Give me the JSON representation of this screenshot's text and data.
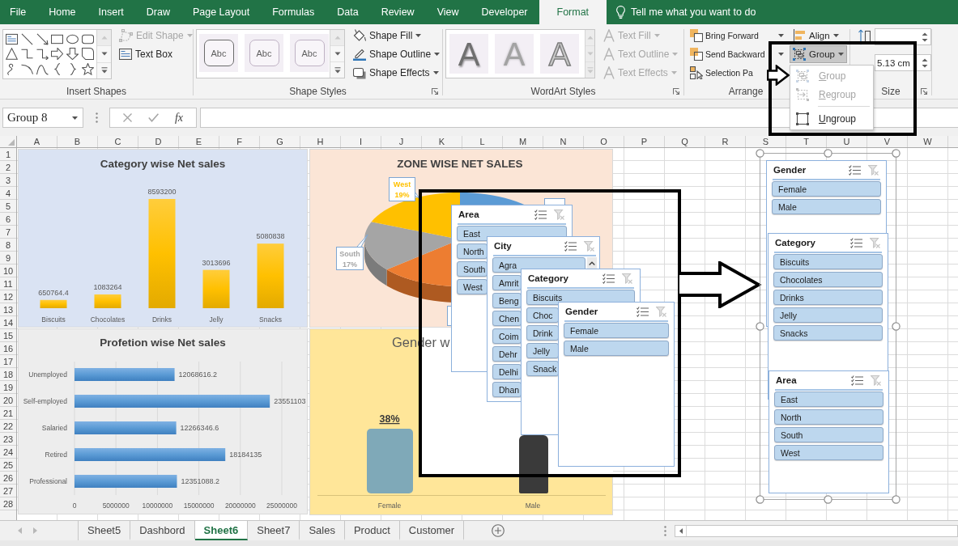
{
  "ribbon": {
    "tabs": [
      {
        "label": "File",
        "selected": false
      },
      {
        "label": "Home",
        "selected": false
      },
      {
        "label": "Insert",
        "selected": false
      },
      {
        "label": "Draw",
        "selected": false
      },
      {
        "label": "Page Layout",
        "selected": false
      },
      {
        "label": "Formulas",
        "selected": false
      },
      {
        "label": "Data",
        "selected": false
      },
      {
        "label": "Review",
        "selected": false
      },
      {
        "label": "View",
        "selected": false
      },
      {
        "label": "Developer",
        "selected": false
      },
      {
        "label": "Format",
        "selected": true
      }
    ],
    "tell_me": "Tell me what you want to do",
    "insert_shapes": {
      "label": "Insert Shapes",
      "commands": [
        {
          "label": "Edit Shape",
          "menu": true,
          "disabled": true
        },
        {
          "label": "Text Box",
          "menu": false,
          "disabled": false
        }
      ]
    },
    "shape_styles": {
      "label": "Shape Styles",
      "presets": [
        {
          "label": "Abc",
          "kind": "outlined"
        },
        {
          "label": "Abc",
          "kind": "light"
        },
        {
          "label": "Abc",
          "kind": "light"
        }
      ],
      "commands": [
        {
          "label": "Shape Fill",
          "menu": true,
          "disabled": false
        },
        {
          "label": "Shape Outline",
          "menu": true,
          "disabled": false
        },
        {
          "label": "Shape Effects",
          "menu": true,
          "disabled": false
        }
      ]
    },
    "wordart_styles": {
      "label": "WordArt Styles",
      "presets": [
        {
          "label": "A",
          "kind": "solid"
        },
        {
          "label": "A",
          "kind": "faded"
        },
        {
          "label": "A",
          "kind": "outline"
        }
      ],
      "commands": [
        {
          "label": "Text Fill",
          "menu": true,
          "disabled": true
        },
        {
          "label": "Text Outline",
          "menu": true,
          "disabled": true
        },
        {
          "label": "Text Effects",
          "menu": true,
          "disabled": true
        }
      ]
    },
    "arrange": {
      "label": "Arrange",
      "commands": [
        {
          "label": "Bring Forward",
          "menu": true
        },
        {
          "label": "Send Backward",
          "menu": true
        },
        {
          "label": "Selection Pa"
        }
      ],
      "align": {
        "label": "Align",
        "menu": true
      },
      "group": {
        "label": "Group",
        "menu": true,
        "pressed": true
      }
    },
    "size": {
      "label": "Size",
      "width": "5.13 cm"
    },
    "group_menu": [
      {
        "label": "Group",
        "disabled": true
      },
      {
        "label": "Regroup",
        "disabled": true
      },
      {
        "label": "Ungroup",
        "disabled": false
      }
    ]
  },
  "formula_bar": {
    "name_box": "Group 8",
    "function_label": "fx"
  },
  "sheet": {
    "columns": [
      "A",
      "B",
      "C",
      "D",
      "E",
      "F",
      "G",
      "H",
      "I",
      "J",
      "K",
      "L",
      "M",
      "N",
      "O",
      "P",
      "Q",
      "R",
      "S",
      "T",
      "U",
      "V",
      "W"
    ],
    "rows": [
      "1",
      "2",
      "3",
      "4",
      "5",
      "6",
      "7",
      "8",
      "9",
      "10",
      "11",
      "12",
      "13",
      "14",
      "15",
      "16",
      "17",
      "18",
      "19",
      "20",
      "21",
      "22",
      "23",
      "24",
      "25",
      "26",
      "27",
      "28"
    ]
  },
  "category_chart": {
    "chart_data": {
      "type": "bar",
      "title": "Category wise Net sales",
      "categories": [
        "Biscuits",
        "Chocolates",
        "Drinks",
        "Jelly",
        "Snacks"
      ],
      "values": [
        650764.4,
        1083264,
        8593200,
        3013696,
        5080838
      ],
      "data_labels": true
    }
  },
  "profession_chart": {
    "chart_data": {
      "type": "bar",
      "orientation": "horizontal",
      "title": "Profetion wise Net sales",
      "categories": [
        "Unemployed",
        "Self-employed",
        "Salaried",
        "Retired",
        "Professional"
      ],
      "values": [
        12068616.2,
        23551103,
        12266346.6,
        18184135,
        12351088.2
      ],
      "xlim": [
        0,
        25000000
      ],
      "xticks": [
        0,
        5000000,
        10000000,
        15000000,
        20000000,
        25000000
      ],
      "grid": true,
      "data_labels": true
    }
  },
  "zone_chart": {
    "title": "ZONE WISE NET SALES",
    "labels": [
      {
        "zone": "West",
        "percent": "19%",
        "color": "#ffc000"
      },
      {
        "zone": "South",
        "percent": "17%",
        "color": "#a5a5a5"
      }
    ]
  },
  "gender_chart": {
    "title": "Gender w",
    "percent": "38%",
    "categories": [
      "Female",
      "Male"
    ]
  },
  "slicers_before": [
    {
      "title": "Area",
      "kind": "plain",
      "items": [
        {
          "label": "East",
          "selected": true
        },
        {
          "label": "North",
          "selected": true
        },
        {
          "label": "South",
          "selected": true
        },
        {
          "label": "West",
          "selected": true
        }
      ]
    },
    {
      "title": "City",
      "kind": "scrolling",
      "items": [
        {
          "label": "Agra",
          "selected": true
        },
        {
          "label": "Amrit",
          "selected": true
        },
        {
          "label": "Beng",
          "selected": true
        },
        {
          "label": "Chen",
          "selected": true
        },
        {
          "label": "Coim",
          "selected": true
        },
        {
          "label": "Dehr",
          "selected": true
        },
        {
          "label": "Delhi",
          "selected": true
        },
        {
          "label": "Dhan",
          "selected": true
        }
      ]
    },
    {
      "title": "Category",
      "kind": "plain",
      "items": [
        {
          "label": "Biscuits",
          "selected": true
        },
        {
          "label": "Choc",
          "selected": true
        },
        {
          "label": "Drink",
          "selected": true
        },
        {
          "label": "Jelly",
          "selected": true
        },
        {
          "label": "Snack",
          "selected": true
        }
      ]
    },
    {
      "title": "Gender",
      "kind": "plain",
      "items": [
        {
          "label": "Female",
          "selected": true
        },
        {
          "label": "Male",
          "selected": true
        }
      ]
    }
  ],
  "slicers_after": [
    {
      "title": "Gender",
      "kind": "plain",
      "items": [
        {
          "label": "Female",
          "selected": true
        },
        {
          "label": "Male",
          "selected": true
        }
      ]
    },
    {
      "title": "Category",
      "kind": "plain",
      "items": [
        {
          "label": "Biscuits",
          "selected": true
        },
        {
          "label": "Chocolates",
          "selected": true
        },
        {
          "label": "Drinks",
          "selected": true
        },
        {
          "label": "Jelly",
          "selected": true
        },
        {
          "label": "Snacks",
          "selected": true
        }
      ]
    },
    {
      "title": "Area",
      "kind": "plain",
      "items": [
        {
          "label": "East",
          "selected": true
        },
        {
          "label": "North",
          "selected": true
        },
        {
          "label": "South",
          "selected": true
        },
        {
          "label": "West",
          "selected": true
        }
      ]
    }
  ],
  "sheet_tabs": [
    {
      "label": "Sheet5",
      "selected": false
    },
    {
      "label": "Dashbord",
      "selected": false
    },
    {
      "label": "Sheet6",
      "selected": true
    },
    {
      "label": "Sheet7",
      "selected": false
    },
    {
      "label": "Sales",
      "selected": false
    },
    {
      "label": "Product",
      "selected": false
    },
    {
      "label": "Customer",
      "selected": false
    }
  ]
}
